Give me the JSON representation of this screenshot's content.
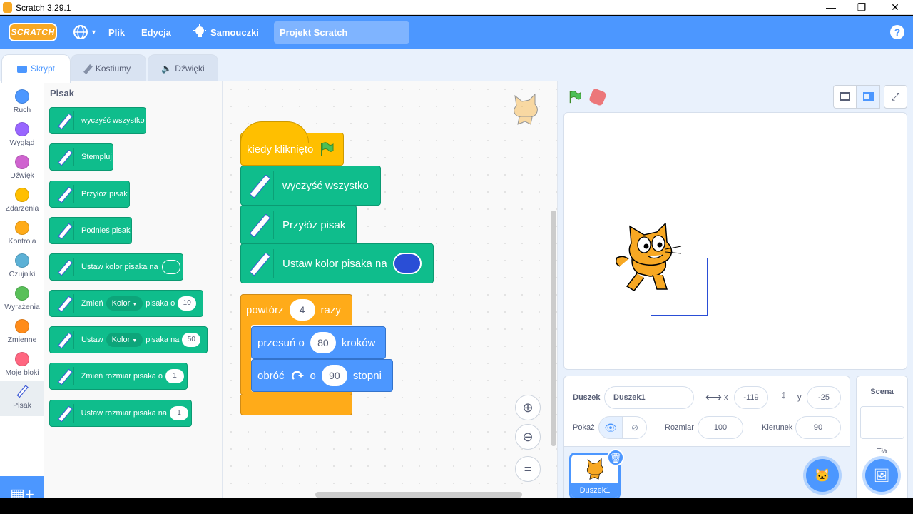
{
  "window": {
    "title": "Scratch 3.29.1"
  },
  "menubar": {
    "logo": "SCRATCH",
    "file": "Plik",
    "edit": "Edycja",
    "tutorials": "Samouczki",
    "project_title": "Projekt Scratch",
    "help": "?"
  },
  "tabs": [
    {
      "label": "Skrypt",
      "icon": "code-icon"
    },
    {
      "label": "Kostiumy",
      "icon": "brush-icon"
    },
    {
      "label": "Dźwięki",
      "icon": "speaker-icon"
    }
  ],
  "categories": [
    {
      "label": "Ruch",
      "color": "#4c97ff"
    },
    {
      "label": "Wygląd",
      "color": "#9966ff"
    },
    {
      "label": "Dźwięk",
      "color": "#cf63cf"
    },
    {
      "label": "Zdarzenia",
      "color": "#ffbf00"
    },
    {
      "label": "Kontrola",
      "color": "#ffab19"
    },
    {
      "label": "Czujniki",
      "color": "#5cb1d6"
    },
    {
      "label": "Wyrażenia",
      "color": "#59c059"
    },
    {
      "label": "Zmienne",
      "color": "#ff8c1a"
    },
    {
      "label": "Moje bloki",
      "color": "#ff6680"
    },
    {
      "label": "Pisak",
      "color": "#0fbd8c"
    }
  ],
  "palette": {
    "title": "Pisak",
    "blocks": {
      "clear": "wyczyść wszystko",
      "stamp": "Stempluj",
      "pen_down": "Przyłóż pisak",
      "pen_up": "Podnieś pisak",
      "set_color": "Ustaw kolor pisaka na",
      "change_param_a": "Zmień",
      "change_param_drop": "Kolor",
      "change_param_b": "pisaka o",
      "change_param_val": "10",
      "set_param_a": "Ustaw",
      "set_param_drop": "Kolor",
      "set_param_b": "pisaka na",
      "set_param_val": "50",
      "change_size": "Zmień rozmiar pisaka o",
      "change_size_val": "1",
      "set_size": "Ustaw rozmiar pisaka na",
      "set_size_val": "1"
    }
  },
  "script": {
    "hat": "kiedy kliknięto",
    "clear": "wyczyść wszystko",
    "pen_down": "Przyłóż pisak",
    "set_color": "Ustaw kolor pisaka na",
    "set_color_value": "#2a4ed6",
    "repeat_a": "powtórz",
    "repeat_val": "4",
    "repeat_b": "razy",
    "move_a": "przesuń o",
    "move_val": "80",
    "move_b": "kroków",
    "turn_a": "obróć",
    "turn_b": "o",
    "turn_val": "90",
    "turn_c": "stopni"
  },
  "sprite_info": {
    "sprite_label": "Duszek",
    "sprite_name": "Duszek1",
    "x_label": "x",
    "x_value": "-119",
    "y_label": "y",
    "y_value": "-25",
    "show_label": "Pokaż",
    "size_label": "Rozmiar",
    "size_value": "100",
    "direction_label": "Kierunek",
    "direction_value": "90"
  },
  "sprite_list": {
    "items": [
      {
        "name": "Duszek1"
      }
    ]
  },
  "stage_pane": {
    "title": "Scena",
    "backdrops_label": "Tła",
    "backdrops_count": "1"
  },
  "colors": {
    "accent": "#4c97ff",
    "pen": "#0fbd8c",
    "control": "#ffab19",
    "events": "#ffbf00",
    "motion": "#4c97ff"
  }
}
